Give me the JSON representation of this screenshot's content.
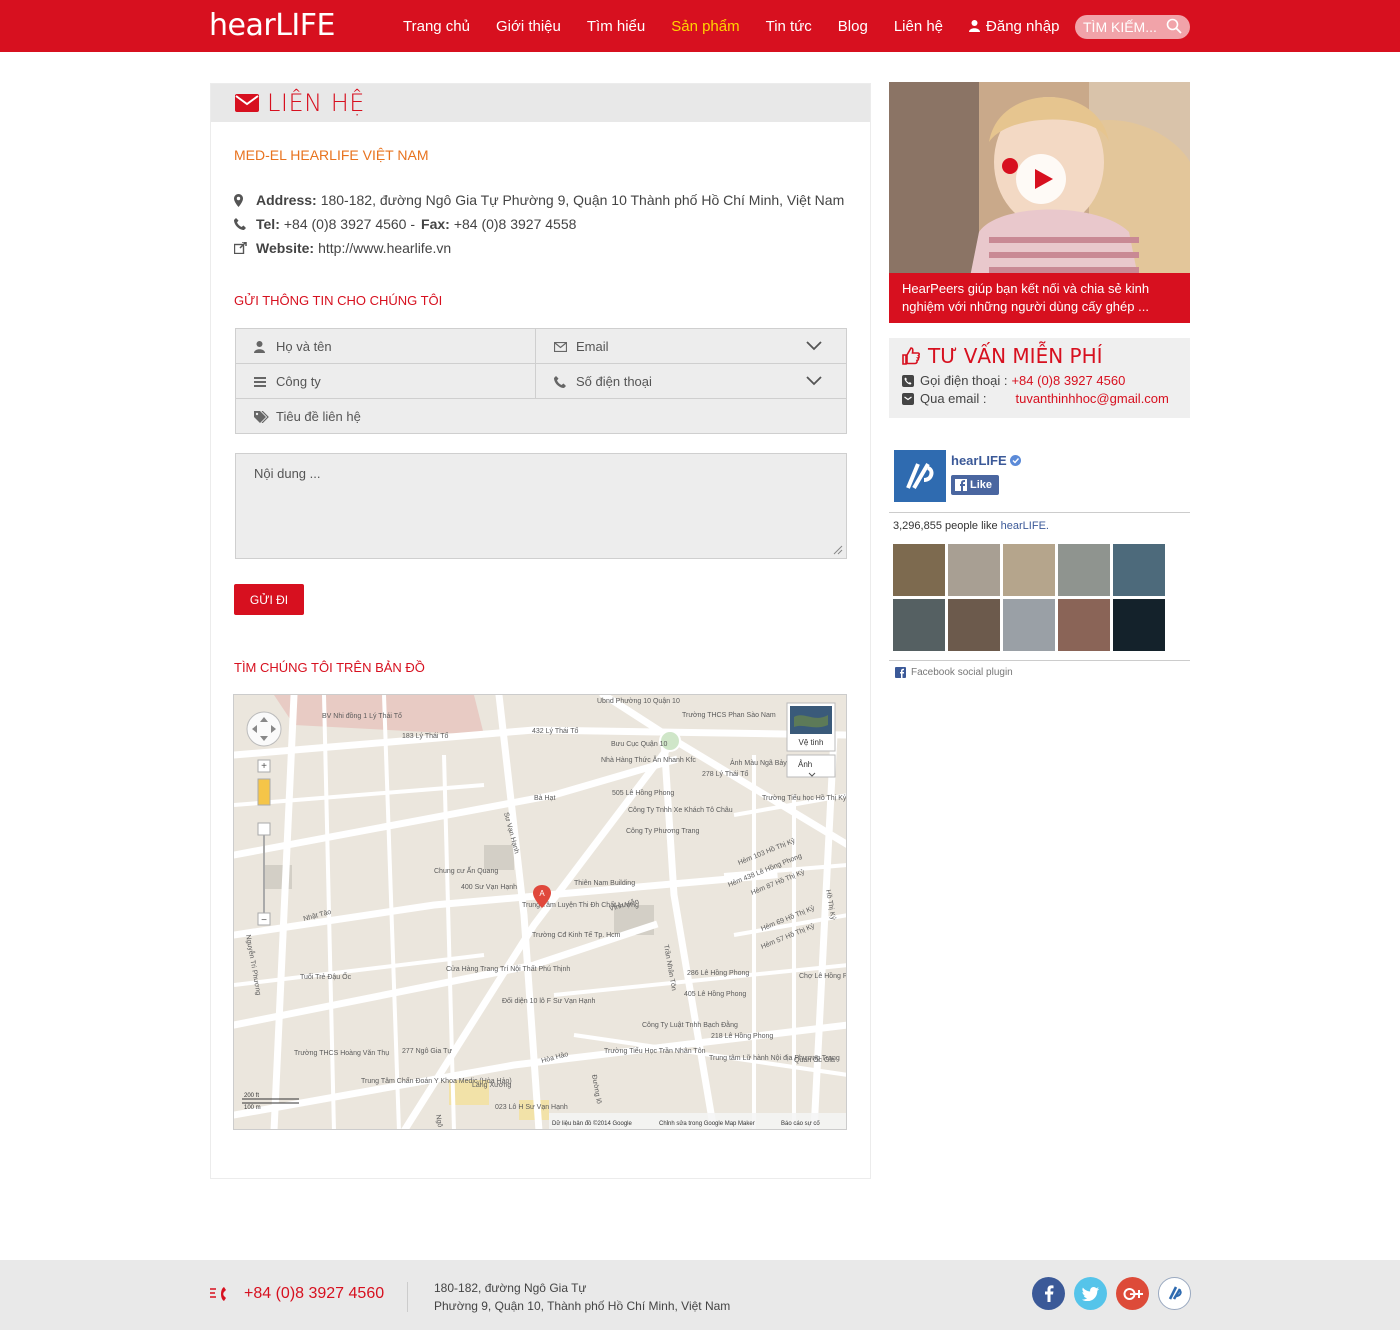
{
  "header": {
    "logo": "hearLIFE",
    "nav": [
      {
        "label": "Trang chủ"
      },
      {
        "label": "Giới thiệu"
      },
      {
        "label": "Tìm hiểu"
      },
      {
        "label": "Sản phẩm"
      },
      {
        "label": "Tin tức"
      },
      {
        "label": "Blog"
      },
      {
        "label": "Liên hệ"
      },
      {
        "label": "Đăng nhập"
      }
    ],
    "search_placeholder": "TÌM KIẾM..."
  },
  "contact": {
    "title": "LIÊN HỆ",
    "org": "MED-EL HEARLIFE VIỆT NAM",
    "address_label": "Address:",
    "address": "180-182, đường Ngô Gia Tự Phường 9, Quận 10 Thành phố Hồ Chí Minh, Việt Nam",
    "tel_label": "Tel:",
    "tel": "+84 (0)8 3927 4560 -",
    "fax_label": "Fax:",
    "fax": "+84 (0)8 3927 4558",
    "website_label": "Website:",
    "website": "http://www.hearlife.vn"
  },
  "form": {
    "heading": "GỬI THÔNG TIN CHO CHÚNG TÔI",
    "name_placeholder": "Họ và tên",
    "email_placeholder": "Email",
    "company_placeholder": "Công ty",
    "phone_placeholder": "Số điện thoại",
    "subject_placeholder": "Tiêu đề liên hệ",
    "message_placeholder": "Nội dung ...",
    "submit": "GỬI ĐI"
  },
  "map": {
    "heading": "TÌM CHÚNG TÔI TRÊN BẢN ĐỒ",
    "satellite": "Vệ tinh",
    "photo": "Ảnh",
    "scale_ft": "200 ft",
    "scale_m": "100 m",
    "attribution": "Dữ liệu bản đồ ©2014 Google",
    "edit": "Chỉnh sửa trong Google Map Maker",
    "report": "Báo cáo sự cố",
    "pin": "A",
    "labels": [
      "BV Nhi đồng 1 Lý Thái Tổ",
      "183 Lý Thái Tổ",
      "432 Lý Thái Tổ",
      "Ubnd Phường 10 Quận 10",
      "Trường THCS Phan Sào Nam",
      "Bưu Cục Quận 10",
      "Nhà Hàng Thức Ăn Nhanh Kfc",
      "Ảnh Màu Ngã Bảy",
      "278 Lý Thái Tổ",
      "Bà Hạt",
      "505 Lê Hồng Phong",
      "Công Ty Tnhh Xe Khách Tô Châu",
      "Công Ty Phương Trang",
      "Trường Tiểu học Hồ Thị Kỷ",
      "Sư Vạn Hạnh",
      "Hẻm 103 Hồ Thị Kỷ",
      "Hẻm 438 Lê Hồng Phong",
      "Hẻm 87 Hồ Thị Kỷ",
      "Chung cư Ấn Quang",
      "400 Sư Vạn Hạnh",
      "Thiên Nam Building",
      "Trung Tâm Luyện Thi Đh Chất Lượng",
      "Vĩnh Viễn",
      "Nhật Tảo",
      "Trường Cđ Kinh Tế Tp. Hcm",
      "Hẻm 69 Hồ Thị Kỷ",
      "Hẻm 57 Hồ Thị Kỷ",
      "Nguyễn Tri Phương",
      "Tuổi Trẻ Đậu Ốc",
      "Cửa Hàng Trang Trí Nội Thất Phú Thịnh",
      "Trần Nhân Tôn",
      "286 Lê Hồng Phong",
      "405 Lê Hồng Phong",
      "Chợ Lê Hồng Phong",
      "Đối diện 10 lô F Sư Vạn Hạnh",
      "Công Ty Luật Tnhh Bạch Đằng",
      "218 Lê Hồng Phong",
      "Trường THCS Hoàng Văn Thụ",
      "277 Ngô Gia Tự",
      "Hòa Hảo",
      "Trường Tiểu Học Trần Nhân Tôn",
      "Trung tâm Lữ hành Nội địa Phương Trang",
      "Quán Ốc Gia",
      "Trung Tâm Chẩn Đoán Y Khoa Medic (Hòa Hảo)",
      "Lãng Xương",
      "023 Lô H Sư Vạn Hạnh",
      "Đường lô",
      "Ngô Gia Tự",
      "Hồ Thị Kỷ"
    ]
  },
  "sidebar": {
    "video_caption": "HearPeers giúp bạn kết nối và chia sẻ kinh nghiệm với những người dùng cấy ghép ...",
    "consult_title": "TƯ VẤN MIỄN PHÍ",
    "phone_label": "Gọi điện thoại :",
    "phone": "+84 (0)8 3927 4560",
    "email_label": "Qua email :",
    "email": "tuvanthinhhoc@gmail.com"
  },
  "facebook": {
    "page_name": "hearLIFE",
    "like": "Like",
    "count_text": "3,296,855 people like",
    "count_page": "hearLIFE.",
    "plugin": "Facebook social plugin"
  },
  "footer": {
    "phone": "+84 (0)8 3927 4560",
    "address_line1": "180-182, đường Ngô Gia Tự",
    "address_line2": "Phường 9, Quận 10, Thành phố Hồ Chí Minh, Việt Nam"
  },
  "colors": {
    "brand_red": "#d7101f",
    "accent_orange": "#e8731f",
    "nav_active": "#ffd400",
    "facebook": "#3b5998",
    "twitter": "#55c4ea",
    "google": "#dd4b39",
    "ios": "#ffffff"
  },
  "icons": [
    "search-icon",
    "user-icon",
    "envelope-icon",
    "map-marker-icon",
    "phone-icon",
    "external-link-icon",
    "bars-icon",
    "tag-icon",
    "chevron-down-icon",
    "thumbs-up-icon",
    "play-icon",
    "facebook-icon",
    "twitter-icon",
    "google-plus-icon",
    "phone-ring-icon"
  ]
}
